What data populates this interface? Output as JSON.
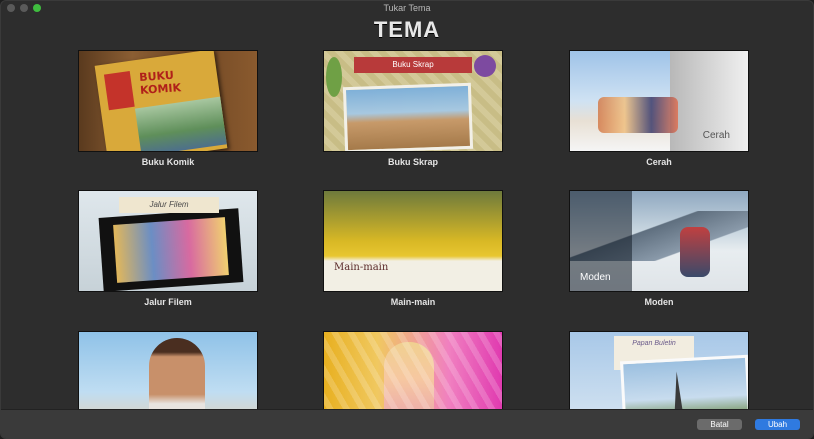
{
  "window": {
    "title": "Tukar Tema"
  },
  "heading": "TEMA",
  "themes": [
    {
      "label": "Buku Komik",
      "thumb_text": "BUKU KOMIK"
    },
    {
      "label": "Buku Skrap",
      "thumb_text": "Buku Skrap"
    },
    {
      "label": "Cerah",
      "thumb_text": "Cerah"
    },
    {
      "label": "Jalur Filem",
      "thumb_text": "Jalur Filem"
    },
    {
      "label": "Main-main",
      "thumb_text": "Main-main"
    },
    {
      "label": "Moden",
      "thumb_text": "Moden"
    },
    {
      "label": "",
      "thumb_text": ""
    },
    {
      "label": "",
      "thumb_text": ""
    },
    {
      "label": "",
      "thumb_text": "Papan Buletin"
    }
  ],
  "buttons": {
    "cancel": "Batal",
    "ok": "Ubah"
  },
  "colors": {
    "accent": "#2f7ae0",
    "traffic_green": "#3fbd3f"
  }
}
